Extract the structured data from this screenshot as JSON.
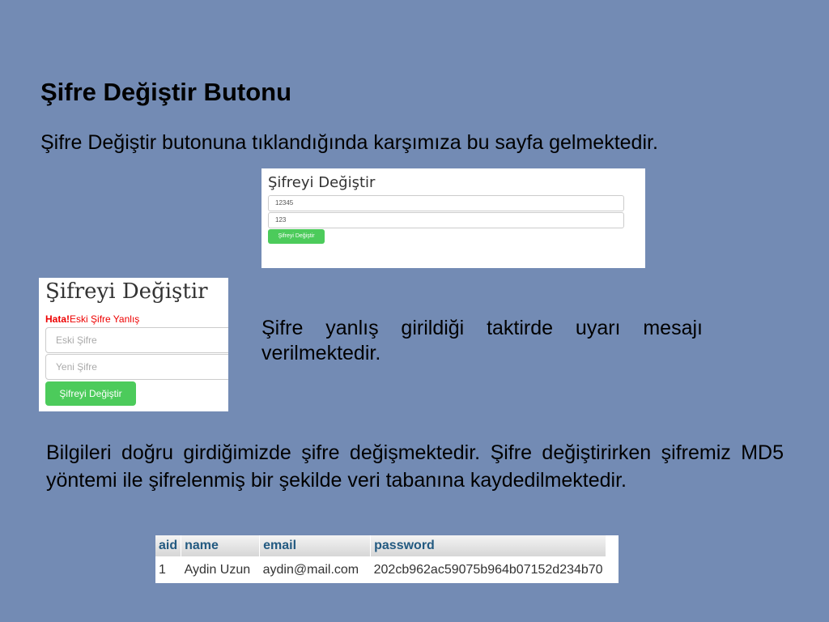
{
  "slide": {
    "title": "Şifre Değiştir Butonu",
    "intro": "Şifre Değiştir butonuna tıklandığında karşımıza bu sayfa gelmektedir.",
    "warning_text": "Şifre yanlış girildiği taktirde uyarı mesajı verilmektedir.",
    "body_text": "Bilgileri doğru girdiğimizde şifre değişmektedir. Şifre değiştirirken şifremiz MD5 yöntemi ile şifrelenmiş bir şekilde veri tabanına kaydedilmektedir."
  },
  "shot1": {
    "heading": "Şifreyi Değiştir",
    "old_value": "12345",
    "new_value": "123",
    "button": "Şifreyi Değiştir"
  },
  "shot2": {
    "heading": "Şifreyi Değiştir",
    "error_prefix": "Hata!",
    "error_text": "Eski Şifre Yanlış",
    "old_placeholder": "Eski Şifre",
    "new_placeholder": "Yeni Şifre",
    "button": "Şifreyi Değiştir"
  },
  "db_table": {
    "headers": [
      "aid",
      "name",
      "email",
      "password"
    ],
    "row": [
      "1",
      "Aydin Uzun",
      "aydin@mail.com",
      "202cb962ac59075b964b07152d234b70"
    ]
  }
}
